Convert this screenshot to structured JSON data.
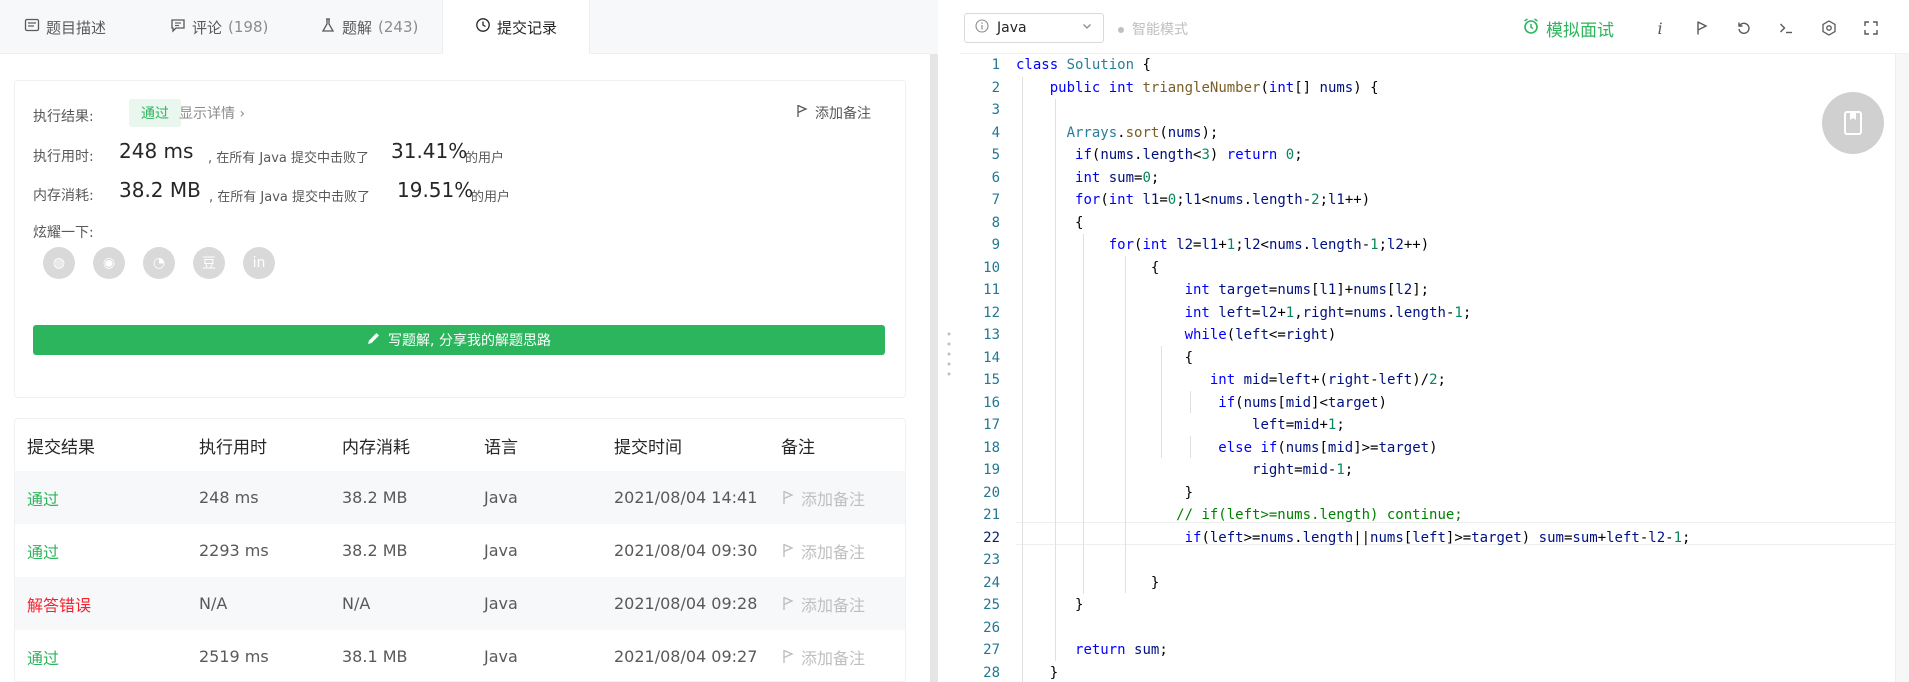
{
  "tabs": [
    {
      "label": "题目描述",
      "count": "",
      "icon": "description-icon"
    },
    {
      "label": "评论",
      "count": "(198)",
      "icon": "comment-icon"
    },
    {
      "label": "题解",
      "count": "(243)",
      "icon": "flask-icon"
    },
    {
      "label": "提交记录",
      "count": "",
      "icon": "clock-icon"
    }
  ],
  "result": {
    "label": "执行结果:",
    "status": "通过",
    "detail": "显示详情 ›",
    "note": "添加备注",
    "time_label": "执行用时:",
    "time_value": "248 ms",
    "time_text": ", 在所有 Java 提交中击败了",
    "time_pct": "31.41%",
    "time_suffix": "的用户",
    "mem_label": "内存消耗:",
    "mem_value": "38.2 MB",
    "mem_text": ", 在所有 Java 提交中击败了",
    "mem_pct": "19.51%",
    "mem_suffix": "的用户",
    "share_label": "炫耀一下:",
    "share_icons": [
      "wechat-icon",
      "weibo-icon",
      "qq-icon",
      "douban-icon",
      "linkedin-icon"
    ],
    "share_glyphs": [
      "◍",
      "◉",
      "◔",
      "豆",
      "in"
    ],
    "write_label": "写题解, 分享我的解题思路"
  },
  "table": {
    "headers": [
      "提交结果",
      "执行用时",
      "内存消耗",
      "语言",
      "提交时间",
      "备注"
    ],
    "rows": [
      {
        "status": "通过",
        "ok": true,
        "time": "248 ms",
        "mem": "38.2 MB",
        "lang": "Java",
        "date": "2021/08/04 14:41",
        "note": "添加备注"
      },
      {
        "status": "通过",
        "ok": true,
        "time": "2293 ms",
        "mem": "38.2 MB",
        "lang": "Java",
        "date": "2021/08/04 09:30",
        "note": "添加备注"
      },
      {
        "status": "解答错误",
        "ok": false,
        "time": "N/A",
        "mem": "N/A",
        "lang": "Java",
        "date": "2021/08/04 09:28",
        "note": "添加备注"
      },
      {
        "status": "通过",
        "ok": true,
        "time": "2519 ms",
        "mem": "38.1 MB",
        "lang": "Java",
        "date": "2021/08/04 09:27",
        "note": "添加备注"
      }
    ]
  },
  "toolbar": {
    "language": "Java",
    "smart_mode": "智能模式",
    "mock_interview": "模拟面试"
  },
  "colors": {
    "accent": "#2db55d",
    "error": "#f5222d"
  },
  "editor": {
    "active_line": 22,
    "lines": [
      "class Solution {",
      "    public int triangleNumber(int[] nums) {",
      "",
      "      Arrays.sort(nums);",
      "       if(nums.length<3) return 0;",
      "       int sum=0;",
      "       for(int l1=0;l1<nums.length-2;l1++)",
      "       {",
      "           for(int l2=l1+1;l2<nums.length-1;l2++)",
      "                {",
      "                    int target=nums[l1]+nums[l2];",
      "                    int left=l2+1,right=nums.length-1;",
      "                    while(left<=right)",
      "                    {",
      "                       int mid=left+(right-left)/2;",
      "                        if(nums[mid]<target)",
      "                            left=mid+1;",
      "                        else if(nums[mid]>=target)",
      "                            right=mid-1;",
      "                    }",
      "                   // if(left>=nums.length) continue;",
      "                    if(left>=nums.length||nums[left]>=target) sum=sum+left-l2-1;",
      "",
      "                }",
      "       }",
      "",
      "       return sum;",
      "    }"
    ]
  }
}
